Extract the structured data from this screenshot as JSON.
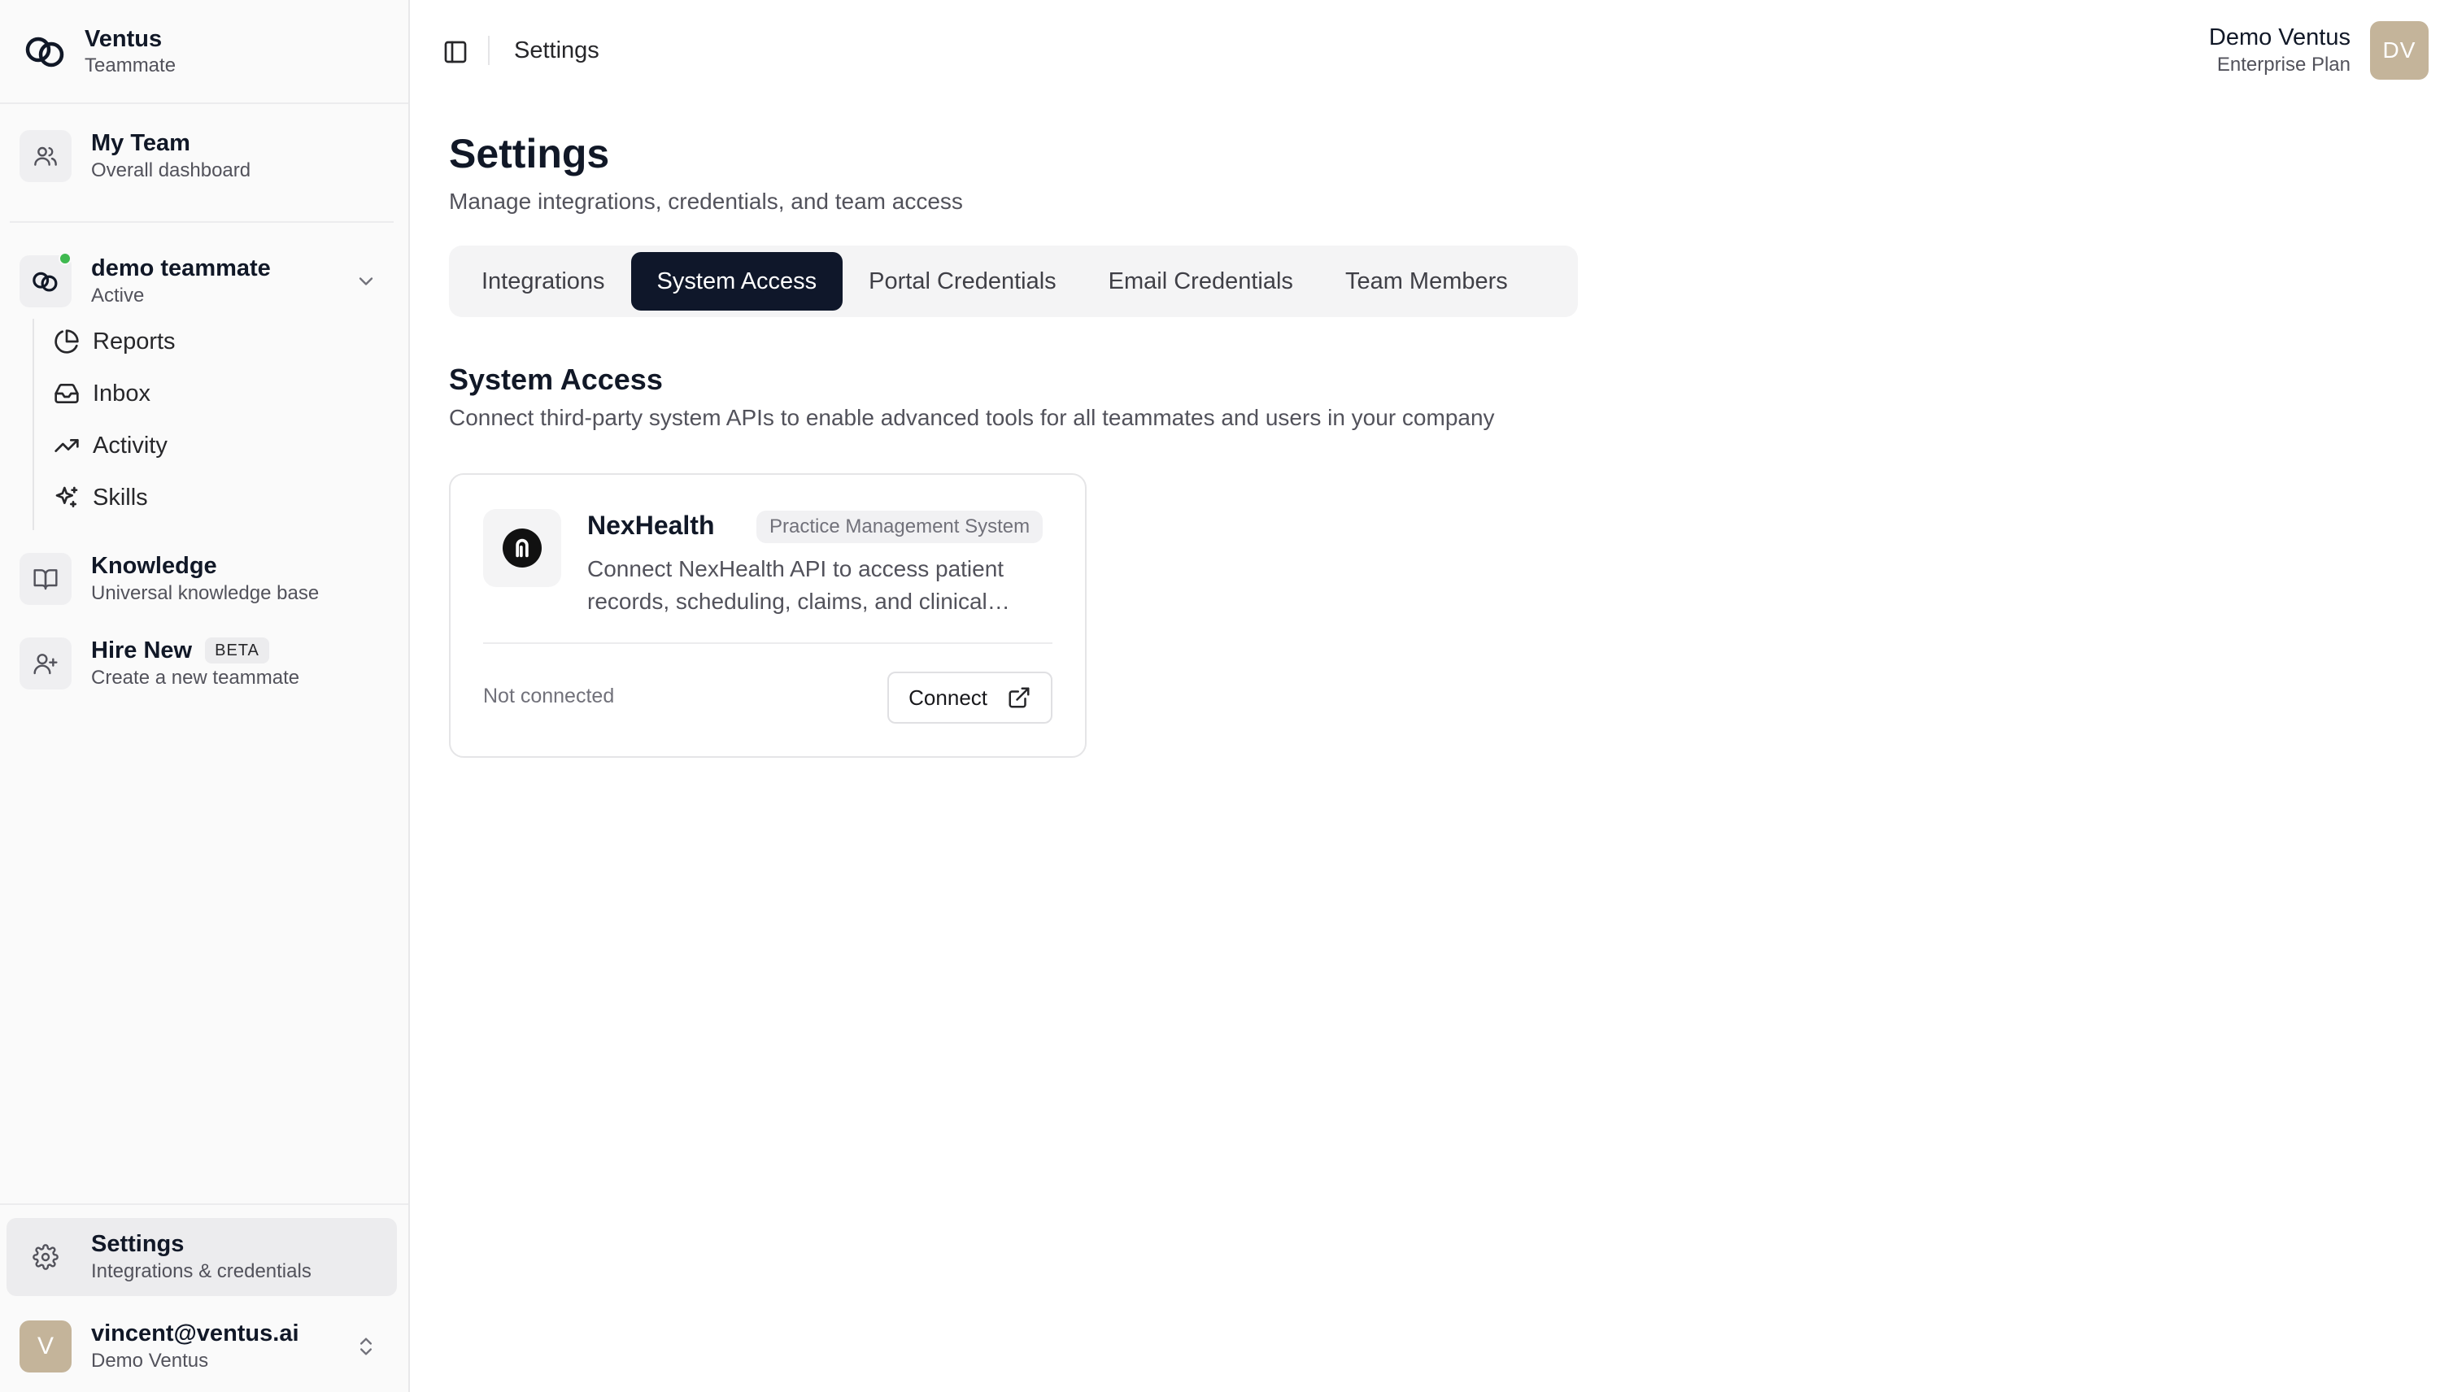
{
  "brand": {
    "name": "Ventus",
    "subtitle": "Teammate"
  },
  "sidebar": {
    "my_team": {
      "title": "My Team",
      "subtitle": "Overall dashboard"
    },
    "teammate": {
      "name": "demo teammate",
      "status": "Active",
      "status_color": "#3fb950"
    },
    "subnav": [
      {
        "label": "Reports",
        "icon": "pie-chart-icon"
      },
      {
        "label": "Inbox",
        "icon": "inbox-icon"
      },
      {
        "label": "Activity",
        "icon": "trending-up-icon"
      },
      {
        "label": "Skills",
        "icon": "sparkles-icon"
      }
    ],
    "knowledge": {
      "title": "Knowledge",
      "subtitle": "Universal knowledge base"
    },
    "hire_new": {
      "title": "Hire New",
      "badge": "BETA",
      "subtitle": "Create a new teammate"
    },
    "settings": {
      "title": "Settings",
      "subtitle": "Integrations & credentials"
    },
    "account": {
      "initial": "V",
      "email": "vincent@ventus.ai",
      "org": "Demo Ventus"
    }
  },
  "topbar": {
    "title": "Settings",
    "user": {
      "name": "Demo Ventus",
      "plan": "Enterprise Plan",
      "initials": "DV"
    }
  },
  "page": {
    "title": "Settings",
    "subtitle": "Manage integrations, credentials, and team access"
  },
  "tabs": [
    {
      "label": "Integrations",
      "active": false
    },
    {
      "label": "System Access",
      "active": true
    },
    {
      "label": "Portal Credentials",
      "active": false
    },
    {
      "label": "Email Credentials",
      "active": false
    },
    {
      "label": "Team Members",
      "active": false
    }
  ],
  "section": {
    "title": "System Access",
    "subtitle": "Connect third-party system APIs to enable advanced tools for all teammates and users in your company"
  },
  "card": {
    "name": "NexHealth",
    "badge": "Practice Management System",
    "description": "Connect NexHealth API to access patient records, scheduling, claims, and clinical…",
    "status": "Not connected",
    "button": "Connect"
  },
  "colors": {
    "accent": "#0f172a",
    "avatar": "#c4b49a",
    "online": "#3fb950"
  }
}
